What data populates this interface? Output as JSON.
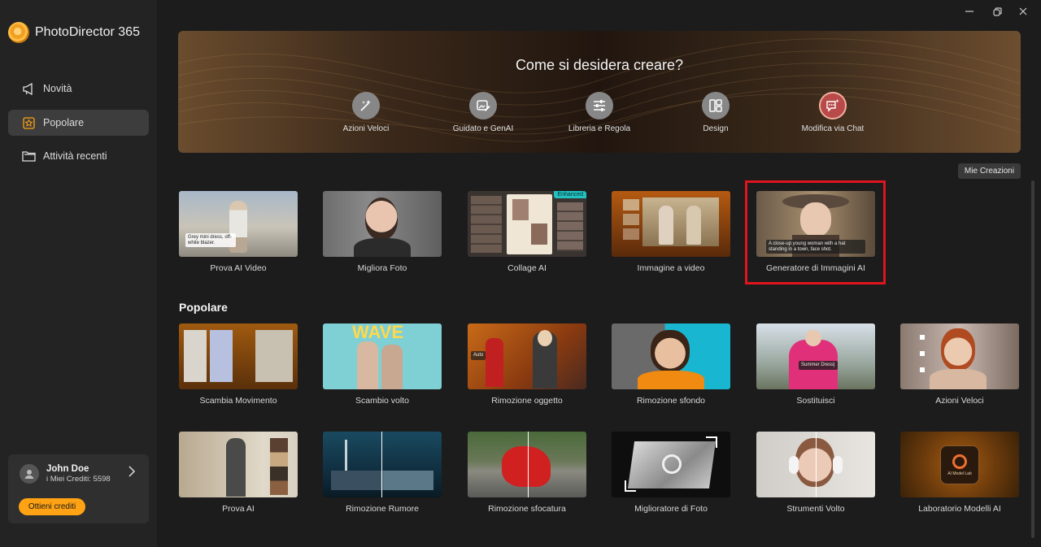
{
  "app": {
    "title": "PhotoDirector 365"
  },
  "sidebar": {
    "items": [
      {
        "label": "Novità",
        "icon": "megaphone-icon"
      },
      {
        "label": "Popolare",
        "icon": "star-icon"
      },
      {
        "label": "Attività recenti",
        "icon": "folder-icon"
      }
    ],
    "account": {
      "name": "John Doe",
      "credits": "i Miei Crediti: 5598",
      "cta": "Ottieni crediti"
    }
  },
  "banner": {
    "title": "Come si desidera creare?",
    "items": [
      {
        "label": "Azioni Veloci",
        "icon": "magic-wand-icon"
      },
      {
        "label": "Guidato e GenAI",
        "icon": "edit-image-icon"
      },
      {
        "label": "Libreria e Regola",
        "icon": "sliders-icon"
      },
      {
        "label": "Design",
        "icon": "layout-icon"
      },
      {
        "label": "Modifica via Chat",
        "icon": "chat-sparkle-icon"
      }
    ]
  },
  "my_creations": "Mie Creazioni",
  "ai_cards": [
    {
      "label": "Prova AI Video",
      "tag": "Grey mini dress, off-white blazer."
    },
    {
      "label": "Migliora Foto"
    },
    {
      "label": "Collage AI",
      "badge": "Enhanced"
    },
    {
      "label": "Immagine a video"
    },
    {
      "label": "Generatore di Immagini AI",
      "tag": "A close-up young woman with a hat standing in a town, face shot."
    }
  ],
  "popular_title": "Popolare",
  "popular_row1": [
    {
      "label": "Scambia Movimento"
    },
    {
      "label": "Scambio volto",
      "tag": "WAVE"
    },
    {
      "label": "Rimozione oggetto",
      "tag": "Auto"
    },
    {
      "label": "Rimozione sfondo"
    },
    {
      "label": "Sostituisci",
      "tag": "Summer Dress|"
    },
    {
      "label": "Azioni Veloci"
    }
  ],
  "popular_row2": [
    {
      "label": "Prova AI"
    },
    {
      "label": "Rimozione Rumore"
    },
    {
      "label": "Rimozione sfocatura"
    },
    {
      "label": "Miglioratore di Foto"
    },
    {
      "label": "Strumenti Volto"
    },
    {
      "label": "Laboratorio Modelli AI",
      "tag": "AI Model Lab"
    }
  ]
}
